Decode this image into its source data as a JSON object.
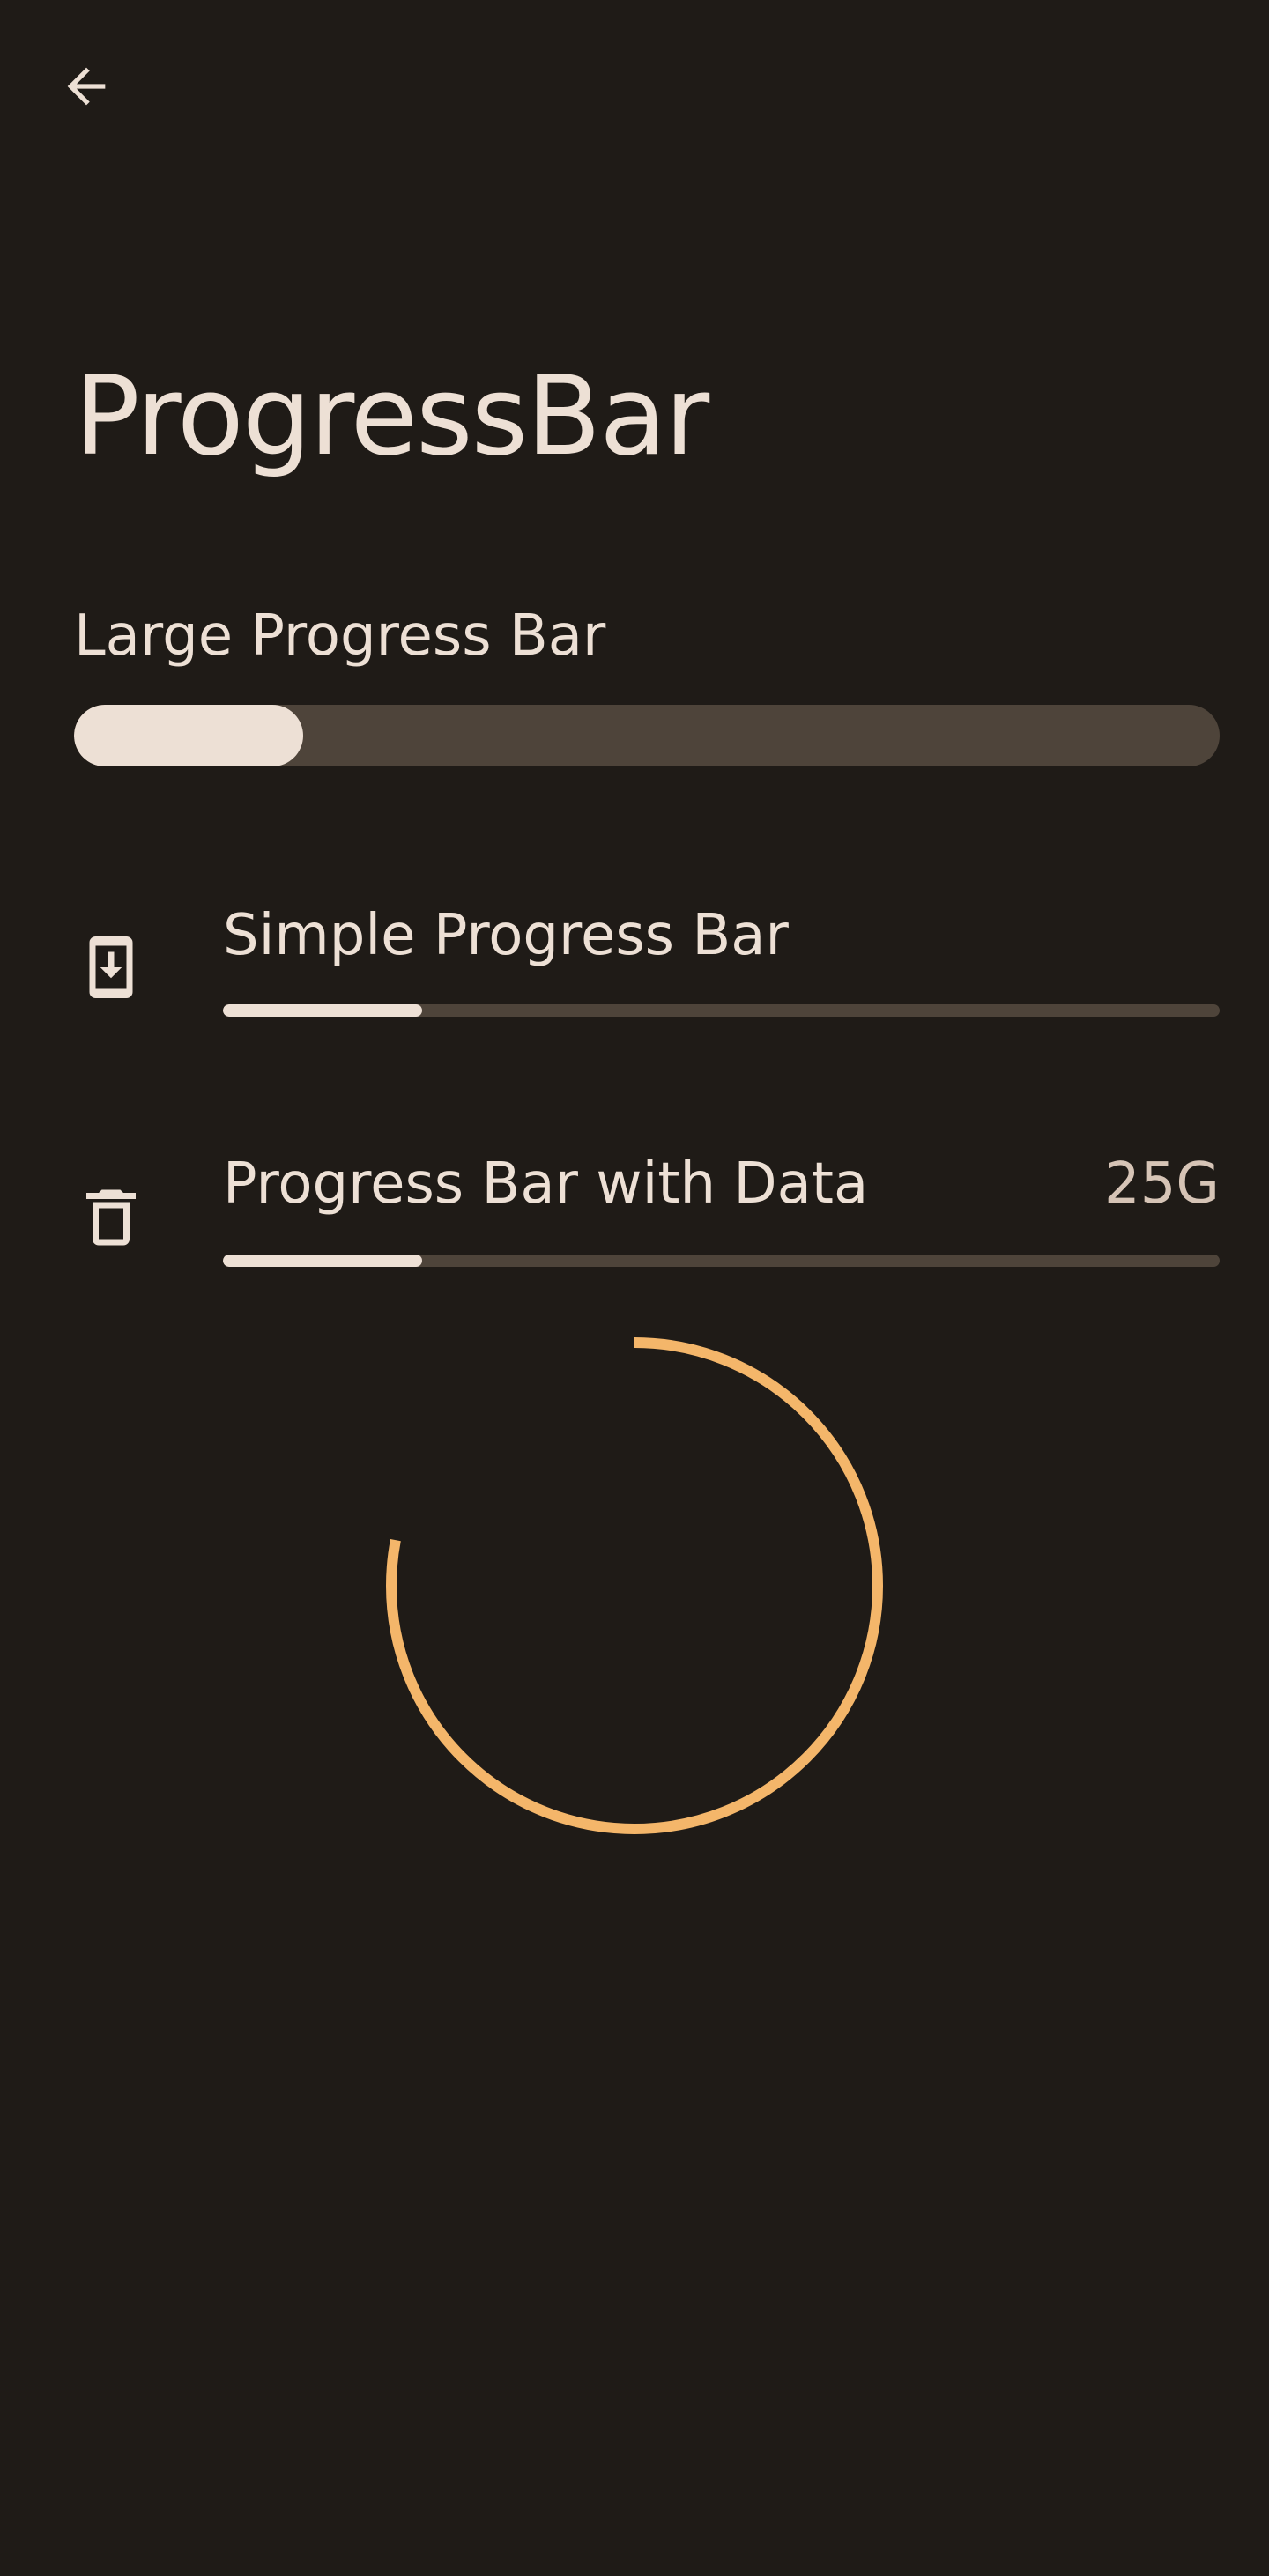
{
  "header": {
    "back_icon": "arrow-back-icon"
  },
  "page": {
    "title": "ProgressBar"
  },
  "large_progress": {
    "label": "Large Progress Bar",
    "progress_fraction": 0.2
  },
  "simple_progress": {
    "icon": "phone-download-icon",
    "label": "Simple Progress Bar",
    "progress_fraction": 0.2
  },
  "data_progress": {
    "icon": "trash-icon",
    "label": "Progress Bar with Data",
    "value": "25G",
    "progress_fraction": 0.2
  },
  "spinner": {
    "icon": "circular-progress-indicator",
    "arc_fraction": 0.78,
    "color": "#f4b66a"
  },
  "colors": {
    "background": "#1f1b17",
    "on_surface": "#ede0d5",
    "track": "#4e443a",
    "accent": "#f4b66a"
  }
}
